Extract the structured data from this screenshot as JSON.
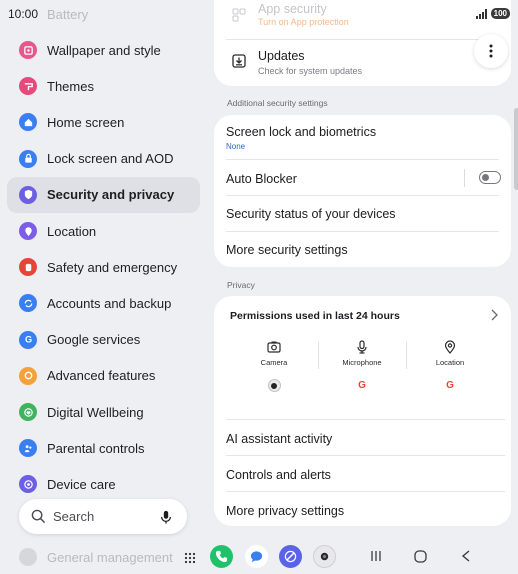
{
  "status": {
    "time": "10:00",
    "battery": "100"
  },
  "left": {
    "faded_top": "Battery",
    "items": [
      {
        "label": "Wallpaper and style",
        "icon": "wallpaper-icon",
        "color": "#e8568e"
      },
      {
        "label": "Themes",
        "icon": "themes-icon",
        "color": "#e9497a"
      },
      {
        "label": "Home screen",
        "icon": "home-icon",
        "color": "#3a7ff2"
      },
      {
        "label": "Lock screen and AOD",
        "icon": "lock-icon",
        "color": "#3a7ff2"
      },
      {
        "label": "Security and privacy",
        "icon": "shield-icon",
        "color": "#6d5fe4"
      },
      {
        "label": "Location",
        "icon": "location-pin-icon",
        "color": "#7b5de8"
      },
      {
        "label": "Safety and emergency",
        "icon": "emergency-icon",
        "color": "#e8453a"
      },
      {
        "label": "Accounts and backup",
        "icon": "sync-icon",
        "color": "#3a7ff2"
      },
      {
        "label": "Google services",
        "icon": "google-g-icon",
        "color": "#3a7ff2"
      },
      {
        "label": "Advanced features",
        "icon": "star-icon",
        "color": "#f3a23a"
      },
      {
        "label": "Digital Wellbeing",
        "icon": "wellbeing-icon",
        "color": "#3fb35e"
      },
      {
        "label": "Parental controls",
        "icon": "parental-icon",
        "color": "#3a7ff2"
      },
      {
        "label": "Device care",
        "icon": "device-care-icon",
        "color": "#6d5fe4"
      }
    ],
    "faded_bottom": "General management",
    "search_label": "Search"
  },
  "right": {
    "top_faded_title": "App security",
    "top_faded_sub": "Turn on App protection",
    "updates_title": "Updates",
    "updates_sub": "Check for system updates",
    "additional_header": "Additional security settings",
    "screen_lock_title": "Screen lock and biometrics",
    "screen_lock_value": "None",
    "auto_blocker": "Auto Blocker",
    "security_status": "Security status of your devices",
    "more_security": "More security settings",
    "privacy_header": "Privacy",
    "permissions_title": "Permissions used in last 24 hours",
    "perm_camera": "Camera",
    "perm_microphone": "Microphone",
    "perm_location": "Location",
    "ai_activity": "AI assistant activity",
    "controls_alerts": "Controls and alerts",
    "more_privacy": "More privacy settings"
  },
  "colors": {
    "accent": "#3a7ff2",
    "orange": "#f08a3e",
    "link_blue": "#2f62c8"
  }
}
